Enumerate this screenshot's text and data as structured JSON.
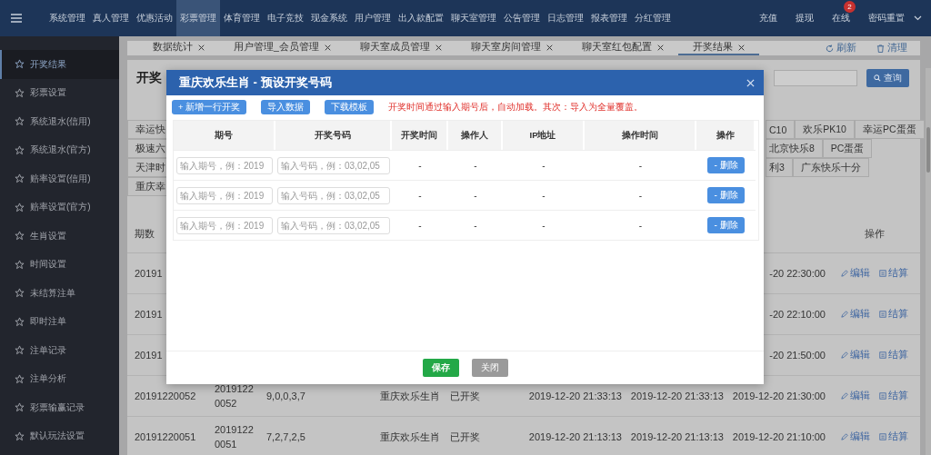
{
  "top_nav": {
    "items": [
      {
        "label": "系统管理",
        "selected": false
      },
      {
        "label": "真人管理",
        "selected": false
      },
      {
        "label": "优惠活动",
        "selected": false
      },
      {
        "label": "彩票管理",
        "selected": true
      },
      {
        "label": "体育管理",
        "selected": false
      },
      {
        "label": "电子竞技",
        "selected": false
      },
      {
        "label": "现金系统",
        "selected": false
      },
      {
        "label": "用户管理",
        "selected": false
      },
      {
        "label": "出入款配置",
        "selected": false
      },
      {
        "label": "聊天室管理",
        "selected": false
      },
      {
        "label": "公告管理",
        "selected": false
      },
      {
        "label": "日志管理",
        "selected": false
      },
      {
        "label": "报表管理",
        "selected": false
      },
      {
        "label": "分红管理",
        "selected": false
      }
    ],
    "right_items": [
      {
        "label": "充值"
      },
      {
        "label": "提现"
      },
      {
        "label": "在线",
        "badge": "2"
      },
      {
        "label": "密码重置"
      }
    ]
  },
  "tabs": [
    {
      "label": "数据统计",
      "selected": false
    },
    {
      "label": "用户管理_会员管理",
      "selected": false
    },
    {
      "label": "聊天室成员管理",
      "selected": false
    },
    {
      "label": "聊天室房间管理",
      "selected": false
    },
    {
      "label": "聊天室红包配置",
      "selected": false
    },
    {
      "label": "开奖结果",
      "selected": true
    }
  ],
  "tab_actions": [
    "刷新",
    "清理"
  ],
  "sidebar": {
    "items": [
      {
        "label": "开奖结果",
        "selected": true
      },
      {
        "label": "彩票设置",
        "selected": false
      },
      {
        "label": "系统退水(信用)",
        "selected": false
      },
      {
        "label": "系统退水(官方)",
        "selected": false
      },
      {
        "label": "赔率设置(信用)",
        "selected": false
      },
      {
        "label": "赔率设置(官方)",
        "selected": false
      },
      {
        "label": "生肖设置",
        "selected": false
      },
      {
        "label": "时间设置",
        "selected": false
      },
      {
        "label": "未结算注单",
        "selected": false
      },
      {
        "label": "即时注单",
        "selected": false
      },
      {
        "label": "注单记录",
        "selected": false
      },
      {
        "label": "注单分析",
        "selected": false
      },
      {
        "label": "彩票输赢记录",
        "selected": false
      },
      {
        "label": "默认玩法设置",
        "selected": false
      }
    ]
  },
  "page": {
    "title": "开奖",
    "search_button": "查询",
    "tags_left": [
      "幸运快",
      "极速六",
      "天津时",
      "重庆幸"
    ],
    "tags_right": [
      [
        "C10",
        "欢乐PK10",
        "幸运PC蛋蛋"
      ],
      [
        "北京快乐8",
        "PC蛋蛋"
      ],
      [
        "利3",
        "广东快乐十分"
      ]
    ],
    "table": {
      "headers": {
        "column_1": "期数",
        "column_9": "操作"
      },
      "rows": [
        {
          "column_1": "20191",
          "column_8": "-20 22:30:00",
          "actions": [
            "编辑",
            "结算"
          ]
        },
        {
          "column_1": "20191",
          "column_8": "-20 22:10:00",
          "actions": [
            "编辑",
            "结算"
          ]
        },
        {
          "column_1": "20191",
          "column_8": "-20 21:50:00",
          "actions": [
            "编辑",
            "结算"
          ]
        },
        {
          "column_1": "20191220052",
          "column_2": "20191220052",
          "column_3": "9,0,0,3,7",
          "column_4": "重庆欢乐生肖",
          "column_5": "已开奖",
          "column_6": "2019-12-20 21:33:13",
          "column_7": "2019-12-20 21:33:13",
          "column_8": "2019-12-20 21:30:00",
          "actions": [
            "编辑",
            "结算"
          ]
        },
        {
          "column_1": "20191220051",
          "column_2": "20191220051",
          "column_3": "7,2,7,2,5",
          "column_4": "重庆欢乐生肖",
          "column_5": "已开奖",
          "column_6": "2019-12-20 21:13:13",
          "column_7": "2019-12-20 21:13:13",
          "column_8": "2019-12-20 21:10:00",
          "actions": [
            "编辑",
            "结算"
          ]
        }
      ]
    }
  },
  "dialog": {
    "title": "重庆欢乐生肖 - 预设开奖号码",
    "toolbar_buttons": [
      "+ 新增一行开奖",
      "导入数据",
      "下载模板"
    ],
    "notice": "开奖时间通过输入期号后，自动加载。其次：导入为全量覆盖。",
    "columns": [
      "期号",
      "开奖号码",
      "开奖时间",
      "操作人",
      "IP地址",
      "操作时间",
      "操作"
    ],
    "rows": [
      {
        "period_placeholder": "输入期号，例：2019",
        "number_placeholder": "输入号码，例：03,02,05",
        "draw_time": "-",
        "operator": "-",
        "ip": "-",
        "operated_at": "-",
        "delete_button": "- 删除"
      },
      {
        "period_placeholder": "输入期号，例：2019",
        "number_placeholder": "输入号码，例：03,02,05",
        "draw_time": "-",
        "operator": "-",
        "ip": "-",
        "operated_at": "-",
        "delete_button": "- 删除"
      },
      {
        "period_placeholder": "输入期号，例：2019",
        "number_placeholder": "输入号码，例：03,02,05",
        "draw_time": "-",
        "operator": "-",
        "ip": "-",
        "operated_at": "-",
        "delete_button": "- 删除"
      }
    ],
    "footer_buttons": [
      {
        "label": "保存",
        "disabled": false
      },
      {
        "label": "关闭",
        "disabled": true
      }
    ]
  }
}
